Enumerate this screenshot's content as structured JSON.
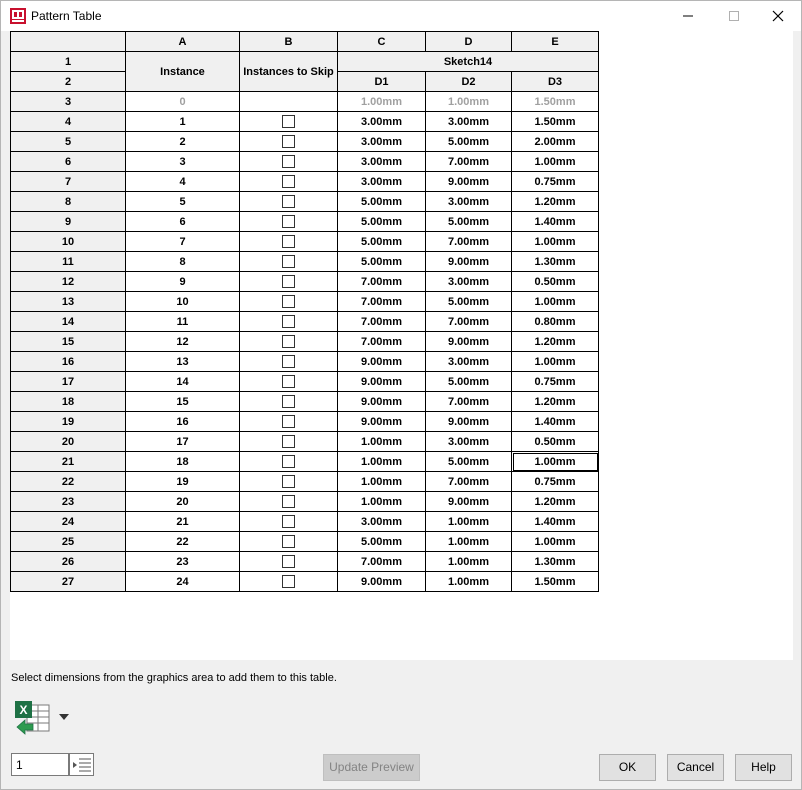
{
  "window": {
    "title": "Pattern Table"
  },
  "table": {
    "col_letters": [
      "A",
      "B",
      "C",
      "D",
      "E"
    ],
    "header_rows": [
      "1",
      "2"
    ],
    "instance_header": "Instance",
    "skip_header": "Instances to Skip",
    "group_header": "Sketch14",
    "dim_headers": [
      "D1",
      "D2",
      "D3"
    ],
    "rows": [
      {
        "row": "3",
        "instance": "0",
        "d1": "1.00mm",
        "d2": "1.00mm",
        "d3": "1.50mm"
      },
      {
        "row": "4",
        "instance": "1",
        "d1": "3.00mm",
        "d2": "3.00mm",
        "d3": "1.50mm"
      },
      {
        "row": "5",
        "instance": "2",
        "d1": "3.00mm",
        "d2": "5.00mm",
        "d3": "2.00mm"
      },
      {
        "row": "6",
        "instance": "3",
        "d1": "3.00mm",
        "d2": "7.00mm",
        "d3": "1.00mm"
      },
      {
        "row": "7",
        "instance": "4",
        "d1": "3.00mm",
        "d2": "9.00mm",
        "d3": "0.75mm"
      },
      {
        "row": "8",
        "instance": "5",
        "d1": "5.00mm",
        "d2": "3.00mm",
        "d3": "1.20mm"
      },
      {
        "row": "9",
        "instance": "6",
        "d1": "5.00mm",
        "d2": "5.00mm",
        "d3": "1.40mm"
      },
      {
        "row": "10",
        "instance": "7",
        "d1": "5.00mm",
        "d2": "7.00mm",
        "d3": "1.00mm"
      },
      {
        "row": "11",
        "instance": "8",
        "d1": "5.00mm",
        "d2": "9.00mm",
        "d3": "1.30mm"
      },
      {
        "row": "12",
        "instance": "9",
        "d1": "7.00mm",
        "d2": "3.00mm",
        "d3": "0.50mm"
      },
      {
        "row": "13",
        "instance": "10",
        "d1": "7.00mm",
        "d2": "5.00mm",
        "d3": "1.00mm"
      },
      {
        "row": "14",
        "instance": "11",
        "d1": "7.00mm",
        "d2": "7.00mm",
        "d3": "0.80mm"
      },
      {
        "row": "15",
        "instance": "12",
        "d1": "7.00mm",
        "d2": "9.00mm",
        "d3": "1.20mm"
      },
      {
        "row": "16",
        "instance": "13",
        "d1": "9.00mm",
        "d2": "3.00mm",
        "d3": "1.00mm"
      },
      {
        "row": "17",
        "instance": "14",
        "d1": "9.00mm",
        "d2": "5.00mm",
        "d3": "0.75mm"
      },
      {
        "row": "18",
        "instance": "15",
        "d1": "9.00mm",
        "d2": "7.00mm",
        "d3": "1.20mm"
      },
      {
        "row": "19",
        "instance": "16",
        "d1": "9.00mm",
        "d2": "9.00mm",
        "d3": "1.40mm"
      },
      {
        "row": "20",
        "instance": "17",
        "d1": "1.00mm",
        "d2": "3.00mm",
        "d3": "0.50mm"
      },
      {
        "row": "21",
        "instance": "18",
        "d1": "1.00mm",
        "d2": "5.00mm",
        "d3": "1.00mm"
      },
      {
        "row": "22",
        "instance": "19",
        "d1": "1.00mm",
        "d2": "7.00mm",
        "d3": "0.75mm"
      },
      {
        "row": "23",
        "instance": "20",
        "d1": "1.00mm",
        "d2": "9.00mm",
        "d3": "1.20mm"
      },
      {
        "row": "24",
        "instance": "21",
        "d1": "3.00mm",
        "d2": "1.00mm",
        "d3": "1.40mm"
      },
      {
        "row": "25",
        "instance": "22",
        "d1": "5.00mm",
        "d2": "1.00mm",
        "d3": "1.00mm"
      },
      {
        "row": "26",
        "instance": "23",
        "d1": "7.00mm",
        "d2": "1.00mm",
        "d3": "1.30mm"
      },
      {
        "row": "27",
        "instance": "24",
        "d1": "9.00mm",
        "d2": "1.00mm",
        "d3": "1.50mm"
      }
    ]
  },
  "hint": "Select dimensions from the graphics area to add them to this table.",
  "icons": {
    "app": "solidworks-app-icon",
    "excel": "excel-table-icon",
    "dropdown": "chevron-down-icon",
    "spinner": "spinner-icon"
  },
  "footer": {
    "number_value": "1",
    "update_preview": "Update Preview",
    "ok": "OK",
    "cancel": "Cancel",
    "help": "Help"
  },
  "colors": {
    "accent_red": "#c8102e",
    "excel_green": "#1e7145",
    "disabled_text": "#a0a0a0"
  }
}
